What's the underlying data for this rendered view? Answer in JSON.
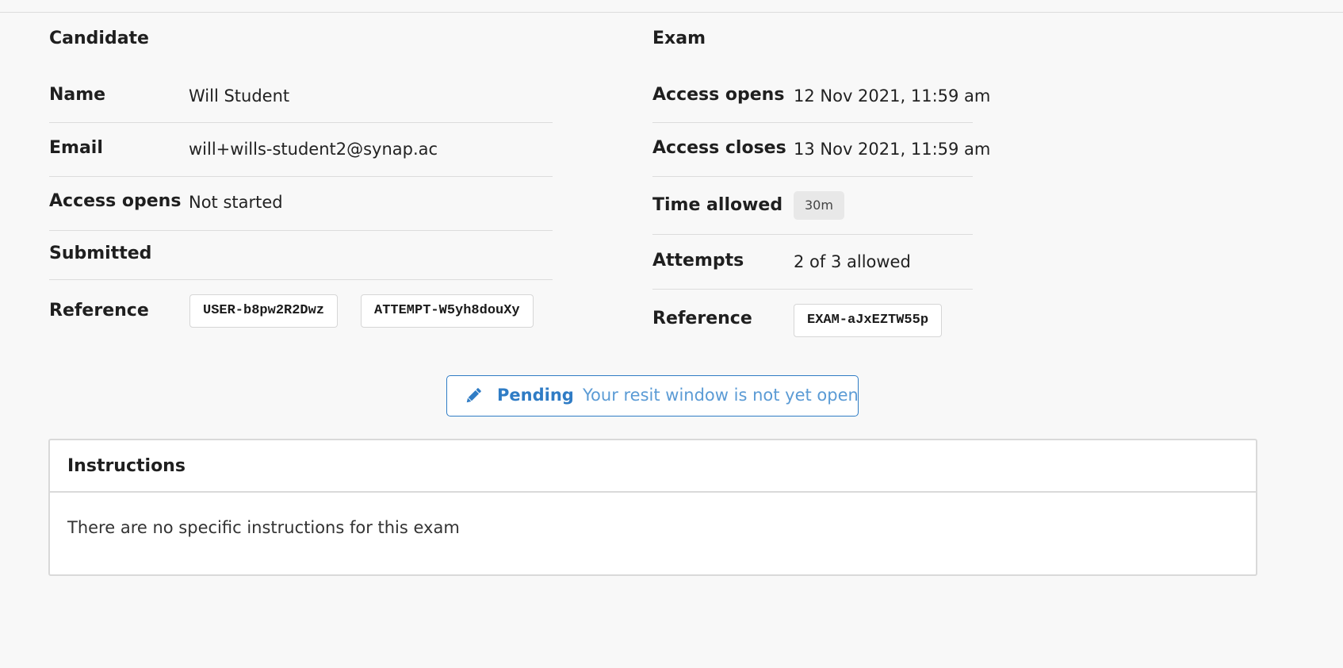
{
  "candidate": {
    "title": "Candidate",
    "name_label": "Name",
    "name_value": "Will Student",
    "email_label": "Email",
    "email_value": "will+wills-student2@synap.ac",
    "access_opens_label": "Access opens",
    "access_opens_value": "Not started",
    "submitted_label": "Submitted",
    "submitted_value": "",
    "reference_label": "Reference",
    "references": [
      "USER-b8pw2R2Dwz",
      "ATTEMPT-W5yh8douXy"
    ]
  },
  "exam": {
    "title": "Exam",
    "access_opens_label": "Access opens",
    "access_opens_value": "12 Nov 2021, 11:59 am",
    "access_closes_label": "Access closes",
    "access_closes_value": "13 Nov 2021, 11:59 am",
    "time_allowed_label": "Time allowed",
    "time_allowed_value": "30m",
    "attempts_label": "Attempts",
    "attempts_value": "2 of 3 allowed",
    "reference_label": "Reference",
    "reference_value": "EXAM-aJxEZTW55p"
  },
  "status": {
    "icon": "pencil-icon",
    "label": "Pending",
    "message": "Your resit window is not yet open",
    "color": "#2f7cc5"
  },
  "instructions": {
    "title": "Instructions",
    "body": "There are no specific instructions for this exam"
  }
}
